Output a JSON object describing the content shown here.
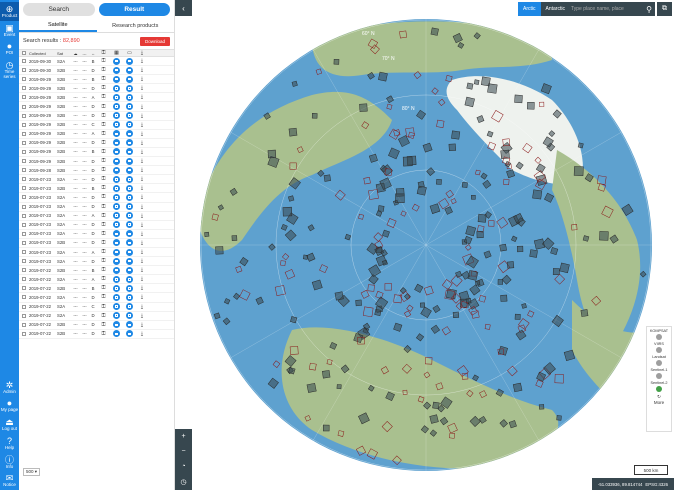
{
  "nav": {
    "items": [
      {
        "label": "Product",
        "icon": "globe-icon"
      },
      {
        "label": "Event",
        "icon": "event-icon"
      },
      {
        "label": "POI",
        "icon": "pin-icon"
      },
      {
        "label": "Time series",
        "icon": "clock-icon"
      }
    ],
    "bottom": [
      {
        "label": "Admin",
        "icon": "gear-icon"
      },
      {
        "label": "My page",
        "icon": "user-icon"
      },
      {
        "label": "Log out",
        "icon": "logout-icon"
      },
      {
        "label": "Help",
        "icon": "help-icon"
      },
      {
        "label": "Info",
        "icon": "info-icon"
      },
      {
        "label": "Notice",
        "icon": "notice-icon"
      }
    ]
  },
  "top_buttons": {
    "search": "Search",
    "result": "Result"
  },
  "tabs": {
    "satellite": "Satellite",
    "research": "Research products"
  },
  "results": {
    "label": "Search results :",
    "count": "82,890",
    "download": "Download"
  },
  "table": {
    "headers": {
      "collected": "Collected",
      "sat": "Sat",
      "cloud": "☁",
      "dash": "---",
      "a": "↔"
    },
    "rows": [
      {
        "date": "2019-09-30",
        "sat": "S2A",
        "a": "B"
      },
      {
        "date": "2019-09-30",
        "sat": "S2B",
        "a": "D"
      },
      {
        "date": "2019-09-29",
        "sat": "S2B",
        "a": "B"
      },
      {
        "date": "2019-09-29",
        "sat": "S2B",
        "a": "D"
      },
      {
        "date": "2019-09-29",
        "sat": "S2B",
        "a": "A"
      },
      {
        "date": "2019-09-29",
        "sat": "S2B",
        "a": "D"
      },
      {
        "date": "2019-09-29",
        "sat": "S2B",
        "a": "D"
      },
      {
        "date": "2019-09-29",
        "sat": "S2B",
        "a": "C"
      },
      {
        "date": "2019-09-29",
        "sat": "S2B",
        "a": "A"
      },
      {
        "date": "2019-09-29",
        "sat": "S2B",
        "a": "D"
      },
      {
        "date": "2019-09-29",
        "sat": "S2B",
        "a": "B"
      },
      {
        "date": "2019-09-29",
        "sat": "S2B",
        "a": "D"
      },
      {
        "date": "2019-09-28",
        "sat": "S2B",
        "a": "D"
      },
      {
        "date": "2019-07-23",
        "sat": "S2A",
        "a": "D"
      },
      {
        "date": "2019-07-23",
        "sat": "S2B",
        "a": "B"
      },
      {
        "date": "2019-07-23",
        "sat": "S2A",
        "a": "D"
      },
      {
        "date": "2019-07-23",
        "sat": "S2A",
        "a": "D"
      },
      {
        "date": "2019-07-23",
        "sat": "S2A",
        "a": "A"
      },
      {
        "date": "2019-07-23",
        "sat": "S2A",
        "a": "D"
      },
      {
        "date": "2019-07-23",
        "sat": "S2A",
        "a": "D"
      },
      {
        "date": "2019-07-23",
        "sat": "S2B",
        "a": "D"
      },
      {
        "date": "2019-07-23",
        "sat": "S2A",
        "a": "A"
      },
      {
        "date": "2019-07-23",
        "sat": "S2A",
        "a": "D"
      },
      {
        "date": "2019-07-22",
        "sat": "S2B",
        "a": "B"
      },
      {
        "date": "2019-07-22",
        "sat": "S2A",
        "a": "A"
      },
      {
        "date": "2019-07-22",
        "sat": "S2B",
        "a": "B"
      },
      {
        "date": "2019-07-22",
        "sat": "S2A",
        "a": "D"
      },
      {
        "date": "2019-07-22",
        "sat": "S2A",
        "a": "C"
      },
      {
        "date": "2019-07-22",
        "sat": "S2A",
        "a": "D"
      },
      {
        "date": "2019-07-22",
        "sat": "S2B",
        "a": "D"
      },
      {
        "date": "2019-07-22",
        "sat": "S2B",
        "a": "D"
      }
    ]
  },
  "footer": {
    "page_size": "500 ▾"
  },
  "map": {
    "projections": {
      "arctic": "Arctic",
      "antarctic": "Antarctic"
    },
    "search_placeholder": "Type place name, place",
    "graticule": [
      "60° N",
      "70° N",
      "80° N"
    ],
    "sensors_title": "KOMPSAT",
    "sensors": [
      "VIIRS",
      "Landsat",
      "Sentinel-1",
      "Sentinel-2"
    ],
    "more": "More",
    "scale": "500 km",
    "coords": "-51.033936, 89.814744",
    "epsg": "EPSG:4326"
  },
  "colors": {
    "accent": "#1e88e5",
    "dark": "#37474f",
    "ocean": "#5ea1cf",
    "land": "#a9c08f"
  }
}
